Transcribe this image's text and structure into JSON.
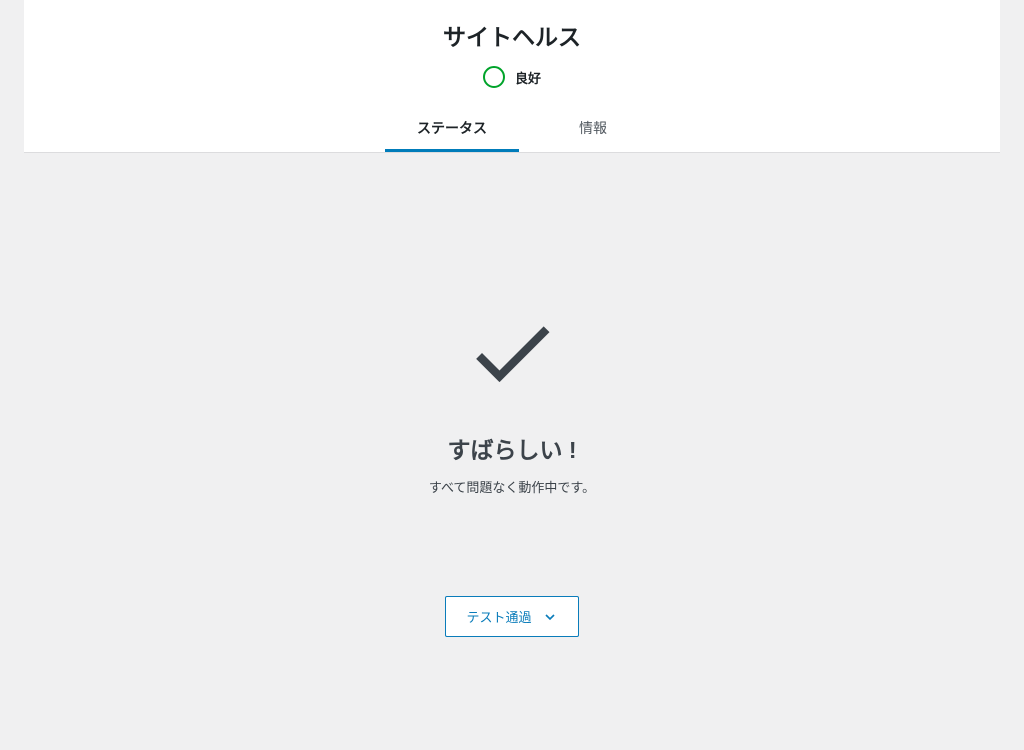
{
  "header": {
    "title": "サイトヘルス",
    "status_label": "良好"
  },
  "tabs": {
    "status": "ステータス",
    "info": "情報"
  },
  "main": {
    "headline": "すばらしい !",
    "subline": "すべて問題なく動作中です。",
    "button_label": "テスト通過"
  }
}
